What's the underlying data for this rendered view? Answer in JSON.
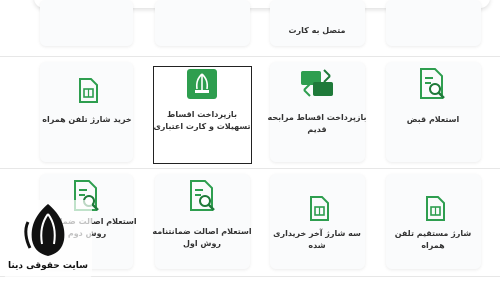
{
  "tiles": [
    {
      "id": "row0-col3",
      "label": "متصل به کارت"
    },
    {
      "id": "sim-purchase",
      "label": "خرید شارژ تلفن همراه"
    },
    {
      "id": "installment",
      "label": "بازپرداخت اقساط تسهیلات و کارت اعتباری"
    },
    {
      "id": "old-installment",
      "label": "بازپرداخت اقساط مرابحه قدیم"
    },
    {
      "id": "bill-inquiry",
      "label": "استعلام قبض"
    },
    {
      "id": "guarantee-2",
      "label": "استعلام اصالت ضمانتنامه روش دوم"
    },
    {
      "id": "guarantee-1",
      "label": "استعلام اصالت ضمانتنامه روش اول"
    },
    {
      "id": "last-three",
      "label": "سه شارژ آخر خریداری شده"
    },
    {
      "id": "direct-charge",
      "label": "شارژ مستقیم تلفن همراه"
    }
  ],
  "watermark": {
    "text": "سایت حقوقی دینا"
  },
  "colors": {
    "icon_green": "#2e9e4f",
    "icon_dark": "#1f7a3a",
    "selected_border": "#222222"
  }
}
